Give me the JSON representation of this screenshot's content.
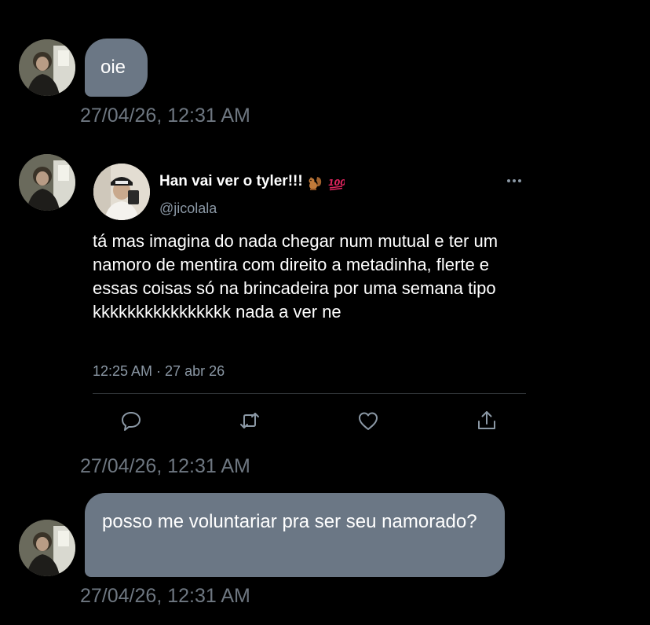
{
  "messages": [
    {
      "text": "oie",
      "timestamp": "27/04/26, 12:31 AM"
    },
    {
      "timestamp": "27/04/26, 12:31 AM"
    },
    {
      "text": "posso me voluntariar pra ser seu namorado?",
      "timestamp": "27/04/26, 12:31 AM"
    }
  ],
  "tweet": {
    "display_name": "Han vai ver o tyler!!!",
    "emojis": [
      "squirrel-emoji",
      "hundred-points-emoji"
    ],
    "handle": "@jicolala",
    "text": "tá mas imagina do nada chegar num mutual e ter um namoro de mentira com direito a metadinha, flerte e essas coisas só na brincadeira por uma semana tipo kkkkkkkkkkkkkkkk nada a ver ne",
    "time": "12:25 AM · 27 abr 26",
    "actions": [
      "reply-icon",
      "retweet-icon",
      "like-icon",
      "share-icon"
    ],
    "more_icon": "more-options-icon"
  },
  "colors": {
    "background": "#000000",
    "bubble": "#6b7785",
    "timestamp": "#6e7781",
    "secondary_text": "#8b98a5",
    "icon": "#8b98a5",
    "divider": "#2f3336"
  }
}
